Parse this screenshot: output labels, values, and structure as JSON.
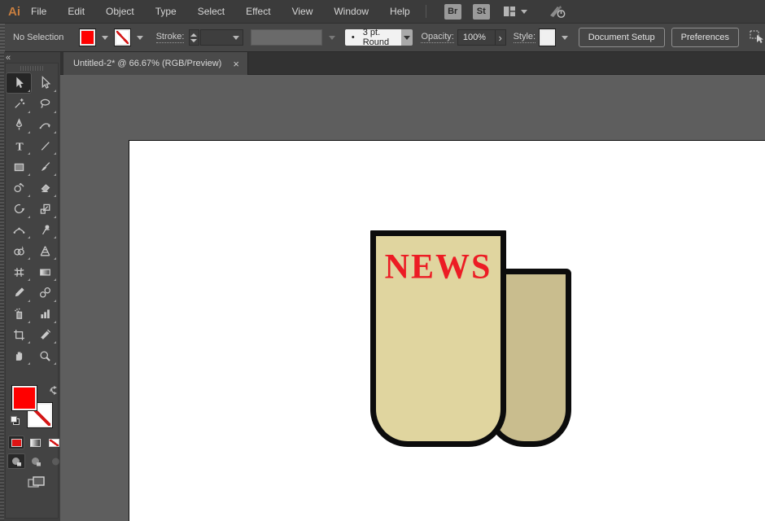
{
  "menubar": {
    "logo": "Ai",
    "items": [
      "File",
      "Edit",
      "Object",
      "Type",
      "Select",
      "Effect",
      "View",
      "Window",
      "Help"
    ],
    "bridge_label": "Br",
    "stock_label": "St"
  },
  "control_bar": {
    "selection_status": "No Selection",
    "fill_color": "#ff0000",
    "stroke_label": "Stroke:",
    "brush_dot": "•",
    "brush_preset": "3 pt. Round",
    "opacity_label": "Opacity:",
    "opacity_value": "100%",
    "opacity_arrow": "›",
    "style_label": "Style:",
    "document_setup_label": "Document Setup",
    "preferences_label": "Preferences"
  },
  "tab_bar": {
    "active_tab_title": "Untitled-2* @ 66.67% (RGB/Preview)",
    "close_glyph": "×"
  },
  "toolbar": {
    "collapse_glyph": "«",
    "active_tool": "selection",
    "fill_color": "#ff0000",
    "stroke_style": "none",
    "tools": [
      "selection",
      "direct-selection",
      "magic-wand",
      "lasso",
      "pen",
      "curvature",
      "type",
      "line-segment",
      "rectangle",
      "paintbrush",
      "shaper",
      "eraser",
      "rotate",
      "scale",
      "width",
      "puppet-warp",
      "shape-builder",
      "perspective-grid",
      "mesh",
      "gradient",
      "eyedropper",
      "blend",
      "symbol-sprayer",
      "column-graph",
      "artboard",
      "slice",
      "hand",
      "zoom"
    ]
  },
  "canvas": {
    "artwork": {
      "headline": "NEWS",
      "headline_color": "#ec1c24",
      "front_sheet_color": "#e0d59f",
      "back_sheet_color": "#c9bd8e",
      "outline_color": "#0c0c0c"
    }
  },
  "colors": {
    "menubar_bg": "#3b3b3b",
    "controlbar_bg": "#464646",
    "panel_bg": "#434343",
    "tabbar_bg": "#323232",
    "active_tab_bg": "#4a4a4a",
    "pasteboard": "#5e5e5e",
    "artboard": "#ffffff",
    "logo_color": "#c87e3f"
  }
}
